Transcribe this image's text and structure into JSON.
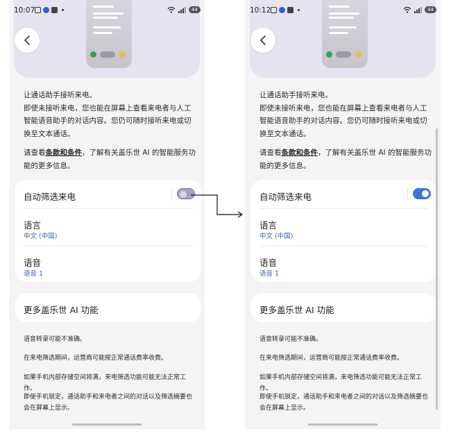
{
  "left": {
    "status_time": "10:07",
    "toggle_state": "off",
    "battery": "44"
  },
  "right": {
    "status_time": "10:12",
    "toggle_state": "on",
    "battery": "44"
  },
  "content": {
    "intro": "让通话助手接听来电。\n即使未接听来电，您也能在屏幕上查看来电者与人工智能语音助手的对话内容。您仍可随时接听来电或切换至文本通话。",
    "terms_prefix": "请查看",
    "terms_link": "条款和条件",
    "terms_suffix": "，了解有关盖乐世 AI 的智能服务功能的更多信息。",
    "auto_screen_label": "自动筛选来电",
    "language_label": "语言",
    "language_value": "中文 (中国)",
    "voice_label": "语音",
    "voice_value": "语音 1",
    "more_ai_label": "更多盖乐世 AI 功能",
    "note1": "语音转录可能不准确。",
    "note2": "在来电筛选期间，运营商可能按正常通话费率收费。",
    "note3": "如果手机内部存储空间将满，来电筛选功能可能无法正常工作。",
    "note4": "即使手机锁定，通话助手和来电者之间的对话以及筛选摘要也会在屏幕上显示。"
  },
  "colors": {
    "toggle_on": "#3d74d8",
    "toggle_off": "#a99fcc",
    "link_blue": "#3a5fb5",
    "background": "#f6f3f6",
    "card": "#ffffff"
  },
  "icons": [
    "back-arrow-icon",
    "wifi-icon",
    "signal-icon",
    "battery-icon",
    "arrow-connector-icon"
  ]
}
